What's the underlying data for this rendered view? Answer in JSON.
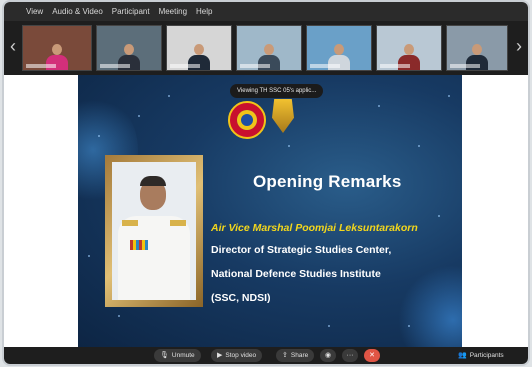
{
  "menu": {
    "items": [
      "View",
      "Audio & Video",
      "Participant",
      "Meeting",
      "Help"
    ]
  },
  "thumbnails": [
    {
      "bg": "#7a4a3a",
      "shirt": "#d32f7a"
    },
    {
      "bg": "#5c6e7a",
      "shirt": "#2a2f3a"
    },
    {
      "bg": "#d6d6d6",
      "shirt": "#1f2a38"
    },
    {
      "bg": "#9fb8c9",
      "shirt": "#3a4a5a"
    },
    {
      "bg": "#6aa0c8",
      "shirt": "#cfd6dd"
    },
    {
      "bg": "#b9c8d4",
      "shirt": "#8a2a2a"
    },
    {
      "bg": "#8a9aa8",
      "shirt": "#1f2a38"
    }
  ],
  "share": {
    "viewing_text": "Viewing TH SSC 05's applic..."
  },
  "slide": {
    "title": "Opening Remarks",
    "name": "Air Vice Marshal  Poomjai Leksuntarakorn",
    "lines": [
      "Director of Strategic Studies Center,",
      "National Defence Studies Institute",
      "(SSC, NDSI)"
    ]
  },
  "toolbar": {
    "unmute_label": "Unmute",
    "stop_video_label": "Stop video",
    "share_label": "Share",
    "participants_label": "Participants"
  },
  "colors": {
    "accent_name": "#f3d71c",
    "end_button": "#e05545",
    "slide_bg": "#173a63"
  }
}
